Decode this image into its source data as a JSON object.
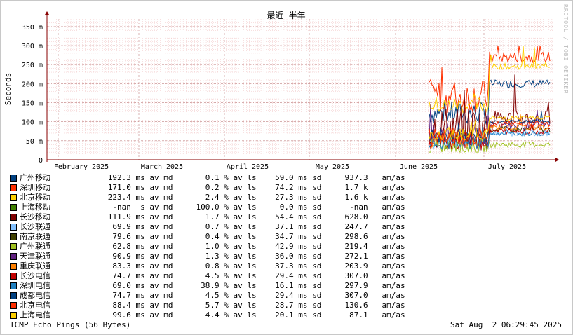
{
  "chart_data": {
    "type": "line",
    "title": "最近 半年",
    "ylabel": "Seconds",
    "y_unit": "m",
    "ylim": [
      0,
      370
    ],
    "yticks": [
      0,
      50,
      100,
      150,
      200,
      250,
      300,
      350
    ],
    "ytick_labels": [
      "0",
      "50 m",
      "100 m",
      "150 m",
      "200 m",
      "250 m",
      "300 m",
      "350 m"
    ],
    "x_months": [
      "February 2025",
      "March 2025",
      "April 2025",
      "May 2025",
      "June 2025",
      "July 2025"
    ],
    "grid": true,
    "series": [
      {
        "name": "广州移动",
        "color": "#004080",
        "stats": {
          "avg": "192.3",
          "loss": "0.1",
          "sd": "59.0",
          "amas": "937.3"
        },
        "base": 200,
        "spread": 20
      },
      {
        "name": "深圳移动",
        "color": "#ff3000",
        "stats": {
          "avg": "171.0",
          "loss": "0.2",
          "sd": "74.2",
          "amas": "1.7 k"
        },
        "base": 270,
        "spread": 30
      },
      {
        "name": "北京移动",
        "color": "#ffd000",
        "stats": {
          "avg": "223.4",
          "loss": "2.4",
          "sd": "27.3",
          "amas": "1.6 k"
        },
        "base": 245,
        "spread": 15
      },
      {
        "name": "上海移动",
        "color": "#408000",
        "stats": {
          "avg": "-nan",
          "unit": "s",
          "loss": "100.0",
          "sd": "0.0",
          "amas": "-nan"
        },
        "base": 0,
        "spread": 0
      },
      {
        "name": "长沙移动",
        "color": "#800000",
        "stats": {
          "avg": "111.9",
          "loss": "1.7",
          "sd": "54.4",
          "amas": "628.0"
        },
        "base": 110,
        "spread": 40
      },
      {
        "name": "长沙联通",
        "color": "#80c0ff",
        "stats": {
          "avg": "69.9",
          "loss": "0.7",
          "sd": "37.1",
          "amas": "247.7"
        },
        "base": 70,
        "spread": 15
      },
      {
        "name": "南京联通",
        "color": "#404000",
        "stats": {
          "avg": "79.6",
          "loss": "0.4",
          "sd": "34.7",
          "amas": "298.6"
        },
        "base": 80,
        "spread": 15
      },
      {
        "name": "广州联通",
        "color": "#a0c020",
        "stats": {
          "avg": "62.8",
          "loss": "1.0",
          "sd": "42.9",
          "amas": "219.4"
        },
        "base": 40,
        "spread": 15
      },
      {
        "name": "天津联通",
        "color": "#602080",
        "stats": {
          "avg": "90.9",
          "loss": "1.3",
          "sd": "36.0",
          "amas": "272.1"
        },
        "base": 90,
        "spread": 20
      },
      {
        "name": "重庆联通",
        "color": "#ff8000",
        "stats": {
          "avg": "83.3",
          "loss": "0.8",
          "sd": "37.3",
          "amas": "203.9"
        },
        "base": 85,
        "spread": 15
      },
      {
        "name": "长沙电信",
        "color": "#c00000",
        "stats": {
          "avg": "74.7",
          "loss": "4.5",
          "sd": "29.4",
          "amas": "307.0"
        },
        "base": 75,
        "spread": 15
      },
      {
        "name": "深圳电信",
        "color": "#2080c0",
        "stats": {
          "avg": "69.0",
          "loss": "38.9",
          "sd": "16.1",
          "amas": "297.9"
        },
        "base": 68,
        "spread": 10
      },
      {
        "name": "成都电信",
        "color": "#004080",
        "stats": {
          "avg": "74.7",
          "loss": "4.5",
          "sd": "29.4",
          "amas": "307.0"
        },
        "base": 100,
        "spread": 10
      },
      {
        "name": "北京电信",
        "color": "#ff3000",
        "stats": {
          "avg": "88.4",
          "loss": "5.7",
          "sd": "28.7",
          "amas": "130.6"
        },
        "base": 95,
        "spread": 15
      },
      {
        "name": "上海电信",
        "color": "#ffd000",
        "stats": {
          "avg": "99.6",
          "loss": "4.4",
          "sd": "20.1",
          "amas": "87.1"
        },
        "base": 110,
        "spread": 12
      }
    ]
  },
  "legend_units": {
    "ms": "ms",
    "av_md": "av md",
    "pct": "%",
    "av_ls": "av ls",
    "sd": "sd",
    "amas": "am/as"
  },
  "footer": {
    "left": "ICMP Echo Pings (56 Bytes)",
    "right": "Sat Aug  2 06:29:45 2025"
  },
  "vertical_label": "RRDTOOL / TOBI OETIKER",
  "colors": {
    "frame_bg": "#ffffff",
    "grid_minor": "#f0c0c0",
    "grid_major": "#c08080",
    "axis": "#880000"
  }
}
